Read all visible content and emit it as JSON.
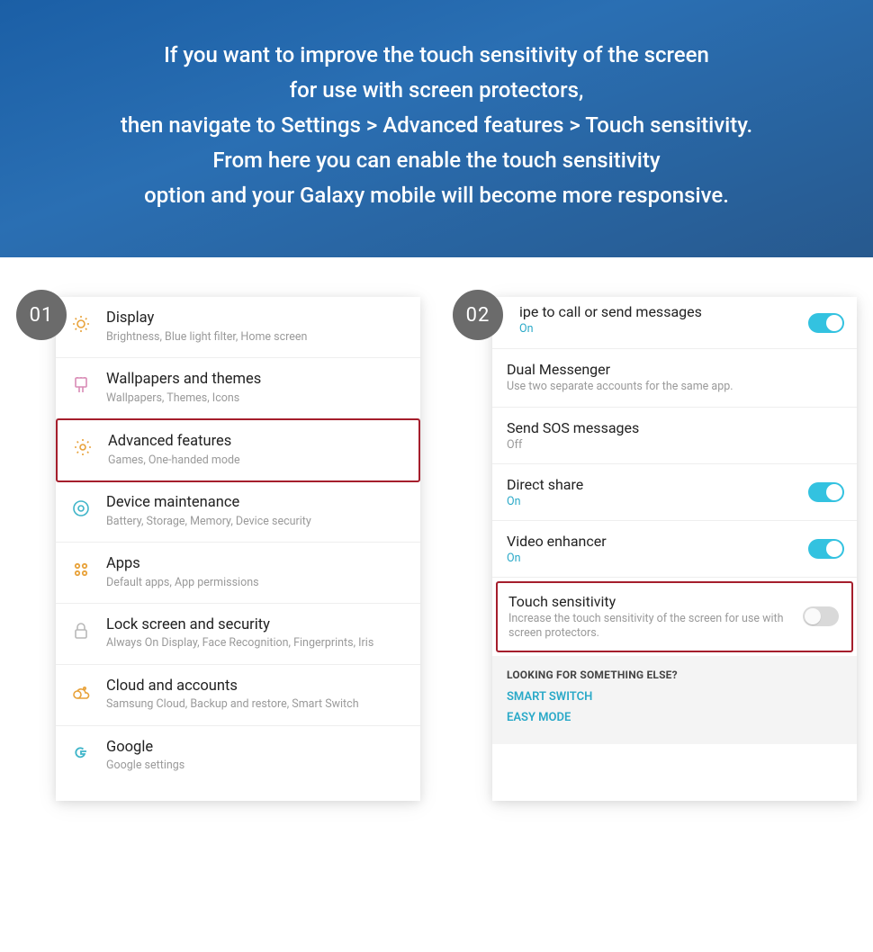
{
  "banner": {
    "line1": "If you want to improve the touch sensitivity of the screen",
    "line2": "for use with screen protectors,",
    "line3": "then navigate to Settings > Advanced features > Touch sensitivity.",
    "line4": "From here you can enable the touch sensitivity",
    "line5": "option and your Galaxy mobile will become more responsive."
  },
  "step1": {
    "badge": "01",
    "items": [
      {
        "icon": "display",
        "title": "Display",
        "sub": "Brightness, Blue light filter, Home screen"
      },
      {
        "icon": "wallpaper",
        "title": "Wallpapers and themes",
        "sub": "Wallpapers, Themes, Icons"
      },
      {
        "icon": "advanced",
        "title": "Advanced features",
        "sub": "Games, One-handed mode",
        "highlight": true
      },
      {
        "icon": "maintenance",
        "title": "Device maintenance",
        "sub": "Battery, Storage, Memory, Device security"
      },
      {
        "icon": "apps",
        "title": "Apps",
        "sub": "Default apps, App permissions"
      },
      {
        "icon": "lock",
        "title": "Lock screen and security",
        "sub": "Always On Display, Face Recognition, Fingerprints, Iris"
      },
      {
        "icon": "cloud",
        "title": "Cloud and accounts",
        "sub": "Samsung Cloud, Backup and restore, Smart Switch"
      },
      {
        "icon": "google",
        "title": "Google",
        "sub": "Google settings"
      }
    ]
  },
  "step2": {
    "badge": "02",
    "items": [
      {
        "title_partial": "ipe to call or send messages",
        "state": "On",
        "toggle": "on",
        "first": true
      },
      {
        "title": "Dual Messenger",
        "sub": "Use two separate accounts for the same app."
      },
      {
        "title": "Send SOS messages",
        "state": "Off"
      },
      {
        "title": "Direct share",
        "state": "On",
        "toggle": "on"
      },
      {
        "title": "Video enhancer",
        "state": "On",
        "toggle": "on"
      },
      {
        "title": "Touch sensitivity",
        "sub": "Increase the touch sensitivity of the screen for use with screen protectors.",
        "toggle": "off",
        "highlight": true
      }
    ],
    "footer": {
      "heading": "LOOKING FOR SOMETHING ELSE?",
      "links": [
        "SMART SWITCH",
        "EASY MODE"
      ]
    }
  },
  "icons": {
    "display": "#e8a23a",
    "wallpaper": "#d98bb5",
    "advanced": "#e8a23a",
    "maintenance": "#3fb5c9",
    "apps": "#e8a23a",
    "lock": "#b8b8b8",
    "cloud": "#e8a23a",
    "google": "#3fb5c9"
  }
}
